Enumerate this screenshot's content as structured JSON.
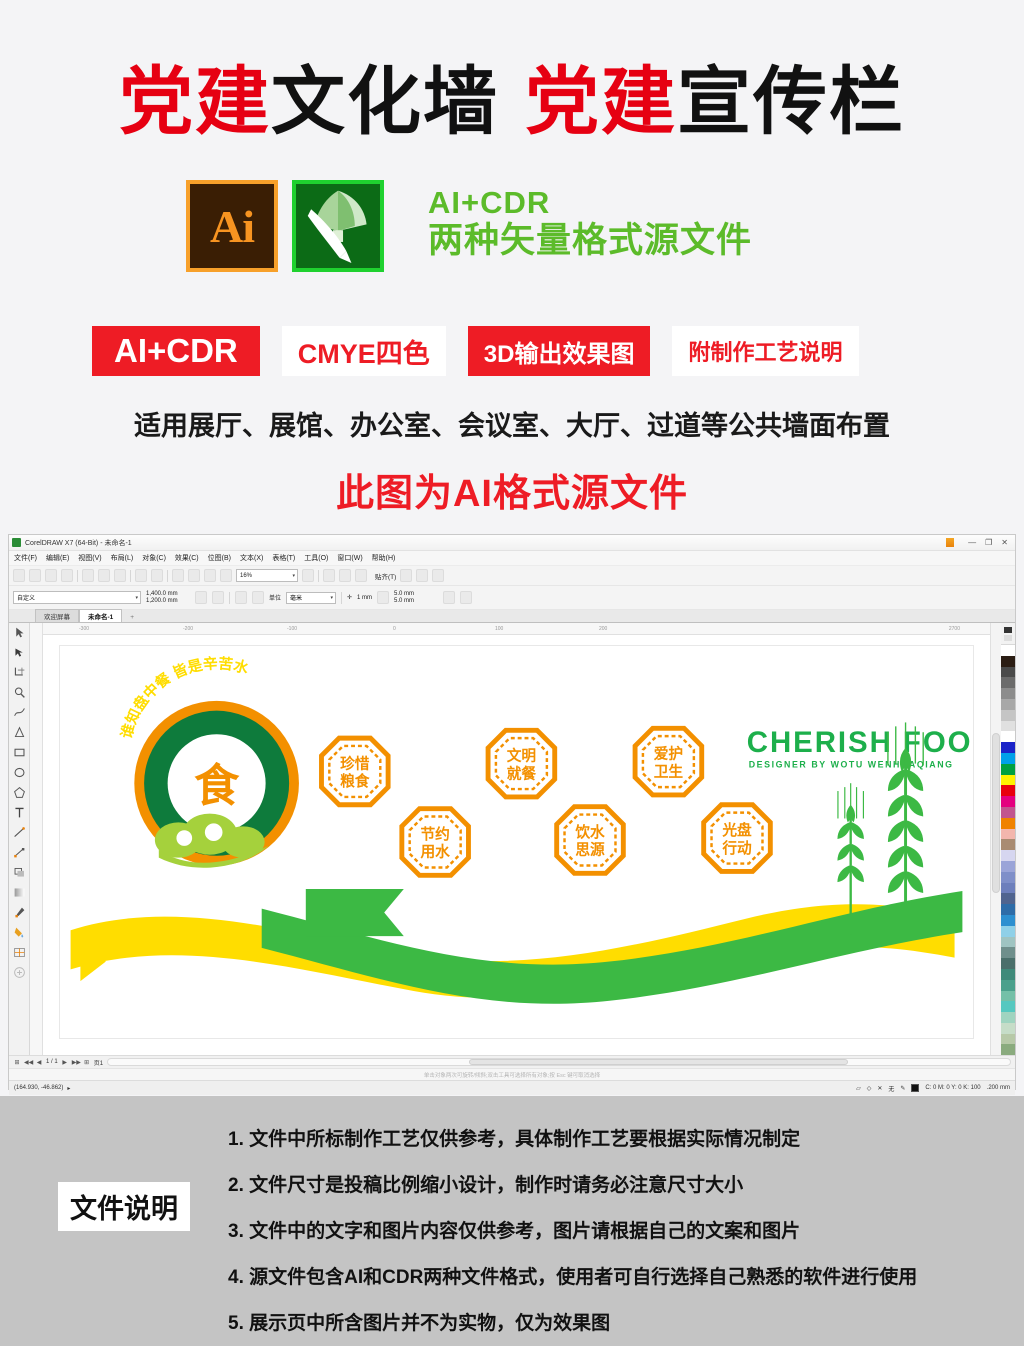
{
  "header": {
    "title_parts": [
      {
        "text": "党建",
        "color": "red"
      },
      {
        "text": "文化墙",
        "color": "black"
      },
      {
        "text": "党建",
        "color": "red"
      },
      {
        "text": "宣传栏",
        "color": "black"
      }
    ],
    "title_full": "党建文化墙 党建宣传栏",
    "red_hex": "#e60012"
  },
  "logos": {
    "ai_label": "Ai",
    "cdr_label": "CorelDRAW",
    "format_line1": "AI+CDR",
    "format_line2": "两种矢量格式源文件",
    "green_hex": "#5cbb2a"
  },
  "badges": [
    {
      "label": "AI+CDR",
      "style": "filled"
    },
    {
      "label": "CMYE四色",
      "style": "outline"
    },
    {
      "label": "3D输出效果图",
      "style": "filled"
    },
    {
      "label": "附制作工艺说明",
      "style": "outline"
    }
  ],
  "apply_line": "适用展厅、展馆、办公室、会议室、大厅、过道等公共墙面布置",
  "ai_note": "此图为AI格式源文件",
  "coreldraw": {
    "title": "CorelDRAW X7 (64-Bit) - 未命名-1",
    "window_controls": [
      "—",
      "❐",
      "✕"
    ],
    "menus": [
      "文件(F)",
      "编辑(E)",
      "视图(V)",
      "布局(L)",
      "对象(C)",
      "效果(C)",
      "位图(B)",
      "文本(X)",
      "表格(T)",
      "工具(O)",
      "窗口(W)",
      "帮助(H)"
    ],
    "toolbar": {
      "zoom_level": "16%",
      "snap_label": "贴齐(T)"
    },
    "property_bar": {
      "preset": "自定义",
      "width": "1,400.0 mm",
      "height": "1,200.0 mm",
      "unit_label": "单位",
      "unit_value": "毫米",
      "nudge": "1 mm",
      "duplicate_x": "5.0 mm",
      "duplicate_y": "5.0 mm"
    },
    "tabs": [
      {
        "label": "欢迎屏幕",
        "active": false
      },
      {
        "label": "未命名-1",
        "active": true
      },
      {
        "label": "+",
        "active": false
      }
    ],
    "ruler_ticks": [
      "-300",
      "-200",
      "-100",
      "0",
      "100",
      "200",
      "2700"
    ],
    "status": {
      "coords": "(164.930, -46.862)",
      "page_indicator": "1 / 1",
      "page_label": "页1",
      "hint": "单击对象两次可旋转/倾斜;双击工具可选择所有对象;按 Esc 键可取消选择",
      "fill_info": "C: 0 M: 0 Y: 0 K: 100",
      "outline_width": ".200 mm",
      "no_fill": "无"
    },
    "artwork": {
      "emblem_center": "食",
      "emblem_arc": "谁知盘中餐 皆是辛苦水",
      "english_title": "CHERISH FOOD",
      "english_sub": "DESIGNER BY WOTU WENHUAQIANG",
      "badges": [
        {
          "line1": "珍惜",
          "line2": "粮食"
        },
        {
          "line1": "节约",
          "line2": "用水"
        },
        {
          "line1": "文明",
          "line2": "就餐"
        },
        {
          "line1": "饮水",
          "line2": "思源"
        },
        {
          "line1": "爱护",
          "line2": "卫生"
        },
        {
          "line1": "光盘",
          "line2": "行动"
        }
      ],
      "colors": {
        "orange": "#F39000",
        "green": "#3CB944",
        "yellow": "#FFDD00",
        "dark_green": "#0E7B3C",
        "light_green": "#A5D13C"
      }
    }
  },
  "footer": {
    "label": "文件说明",
    "notes": [
      "1. 文件中所标制作工艺仅供参考，具体制作工艺要根据实际情况制定",
      "2. 文件尺寸是投稿比例缩小设计，制作时请务必注意尺寸大小",
      "3. 文件中的文字和图片内容仅供参考，图片请根据自己的文案和图片",
      "4. 源文件包含AI和CDR两种文件格式，使用者可自行选择自己熟悉的软件进行使用",
      "5. 展示页中所含图片并不为实物，仅为效果图"
    ]
  }
}
